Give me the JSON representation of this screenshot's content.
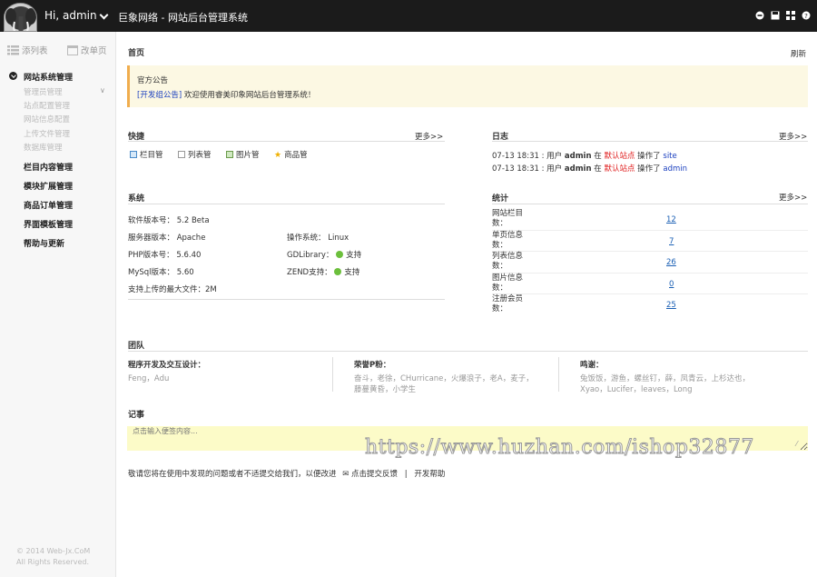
{
  "header": {
    "greeting": "Hi, admin",
    "site_title": "巨象网络 - 网站后台管理系统",
    "icons": [
      "minus-circle-icon",
      "save-icon",
      "grid-icon",
      "help-icon"
    ]
  },
  "sidebar": {
    "add_list": "添列表",
    "edit_list": "改单页",
    "groups": [
      {
        "label": "网站系统管理",
        "expanded": true,
        "items": [
          "管理员管理",
          "站点配置管理",
          "网站信息配置",
          "上传文件管理",
          "数据库管理"
        ]
      },
      {
        "label": "栏目内容管理"
      },
      {
        "label": "模块扩展管理"
      },
      {
        "label": "商品订单管理"
      },
      {
        "label": "界面模板管理"
      },
      {
        "label": "帮助与更新"
      }
    ],
    "copyright_1": "© 2014 Web-Jx.CoM",
    "copyright_2": "All Rights Reserved."
  },
  "page": {
    "title": "首页",
    "refresh": "刷新"
  },
  "notice": {
    "title": "官方公告",
    "link": "[开发组公告]",
    "text": "欢迎使用睿美印象网站后台管理系统！"
  },
  "quick": {
    "title": "快捷",
    "more": "更多>>",
    "items": [
      "栏目管",
      "列表管",
      "图片管",
      "商品管"
    ]
  },
  "log": {
    "title": "日志",
    "more": "更多>>",
    "entries": [
      {
        "time": "07-13 18:31 : 用户",
        "user": "admin",
        "in": "在",
        "site": "默认站点",
        "op": "操作了",
        "target": "site"
      },
      {
        "time": "07-13 18:31 : 用户",
        "user": "admin",
        "in": "在",
        "site": "默认站点",
        "op": "操作了",
        "target": "admin"
      }
    ]
  },
  "system": {
    "title": "系统",
    "software_label": "软件版本号：",
    "software": "5.2 Beta",
    "server_label": "服务器版本：",
    "server": "Apache",
    "os_label": "操作系统：",
    "os": "Linux",
    "php_label": "PHP版本号：",
    "php": "5.6.40",
    "gd_label": "GDLibrary：",
    "gd": "支持",
    "mysql_label": "MySql版本：",
    "mysql": "5.60",
    "zend_label": "ZEND支持：",
    "zend": "支持",
    "upload": "支持上传的最大文件：2M"
  },
  "stats": {
    "title": "统计",
    "more": "更多>>",
    "rows": [
      {
        "l1": "网站栏目",
        "l2": "数：",
        "value": "12"
      },
      {
        "l1": "单页信息",
        "l2": "数：",
        "value": "7"
      },
      {
        "l1": "列表信息",
        "l2": "数：",
        "value": "26"
      },
      {
        "l1": "图片信息",
        "l2": "数：",
        "value": "0"
      },
      {
        "l1": "注册会员",
        "l2": "数：",
        "value": "25"
      }
    ]
  },
  "team": {
    "title": "团队",
    "dev_title": "程序开发及交互设计：",
    "dev": "Feng，Adu",
    "honor_title": "荣誉P粉：",
    "honor_1": "奋斗，老徐，CHurricane，火爆浪子，老A，麦子，",
    "honor_2": "藤蔓黄昏，小学生",
    "thanks_title": "鸣谢：",
    "thanks_1": "兔饭饭，游鱼，螺丝钉，薛，凤青云，上杉达也，",
    "thanks_2": "Xyao，Lucifer，leaves，Long"
  },
  "memo": {
    "title": "记事",
    "placeholder": "点击输入便签内容..."
  },
  "footer": {
    "text": "敬请您将在使用中发现的问题或者不适提交给我们，以便改进",
    "feedback": "点击提交反馈",
    "sep": "|",
    "help": "开发帮助"
  },
  "watermark": "https://www.huzhan.com/ishop32877"
}
